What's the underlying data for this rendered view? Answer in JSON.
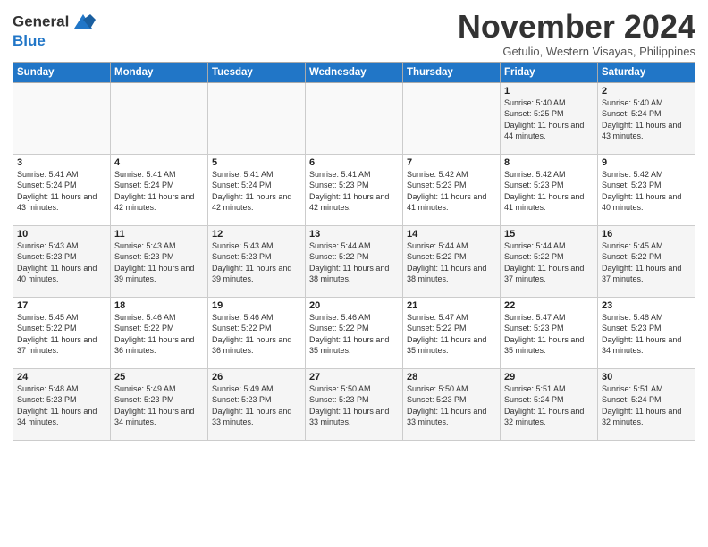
{
  "logo": {
    "line1": "General",
    "line2": "Blue"
  },
  "title": "November 2024",
  "location": "Getulio, Western Visayas, Philippines",
  "days_of_week": [
    "Sunday",
    "Monday",
    "Tuesday",
    "Wednesday",
    "Thursday",
    "Friday",
    "Saturday"
  ],
  "weeks": [
    [
      {
        "day": "",
        "info": ""
      },
      {
        "day": "",
        "info": ""
      },
      {
        "day": "",
        "info": ""
      },
      {
        "day": "",
        "info": ""
      },
      {
        "day": "",
        "info": ""
      },
      {
        "day": "1",
        "info": "Sunrise: 5:40 AM\nSunset: 5:25 PM\nDaylight: 11 hours and 44 minutes."
      },
      {
        "day": "2",
        "info": "Sunrise: 5:40 AM\nSunset: 5:24 PM\nDaylight: 11 hours and 43 minutes."
      }
    ],
    [
      {
        "day": "3",
        "info": "Sunrise: 5:41 AM\nSunset: 5:24 PM\nDaylight: 11 hours and 43 minutes."
      },
      {
        "day": "4",
        "info": "Sunrise: 5:41 AM\nSunset: 5:24 PM\nDaylight: 11 hours and 42 minutes."
      },
      {
        "day": "5",
        "info": "Sunrise: 5:41 AM\nSunset: 5:24 PM\nDaylight: 11 hours and 42 minutes."
      },
      {
        "day": "6",
        "info": "Sunrise: 5:41 AM\nSunset: 5:23 PM\nDaylight: 11 hours and 42 minutes."
      },
      {
        "day": "7",
        "info": "Sunrise: 5:42 AM\nSunset: 5:23 PM\nDaylight: 11 hours and 41 minutes."
      },
      {
        "day": "8",
        "info": "Sunrise: 5:42 AM\nSunset: 5:23 PM\nDaylight: 11 hours and 41 minutes."
      },
      {
        "day": "9",
        "info": "Sunrise: 5:42 AM\nSunset: 5:23 PM\nDaylight: 11 hours and 40 minutes."
      }
    ],
    [
      {
        "day": "10",
        "info": "Sunrise: 5:43 AM\nSunset: 5:23 PM\nDaylight: 11 hours and 40 minutes."
      },
      {
        "day": "11",
        "info": "Sunrise: 5:43 AM\nSunset: 5:23 PM\nDaylight: 11 hours and 39 minutes."
      },
      {
        "day": "12",
        "info": "Sunrise: 5:43 AM\nSunset: 5:23 PM\nDaylight: 11 hours and 39 minutes."
      },
      {
        "day": "13",
        "info": "Sunrise: 5:44 AM\nSunset: 5:22 PM\nDaylight: 11 hours and 38 minutes."
      },
      {
        "day": "14",
        "info": "Sunrise: 5:44 AM\nSunset: 5:22 PM\nDaylight: 11 hours and 38 minutes."
      },
      {
        "day": "15",
        "info": "Sunrise: 5:44 AM\nSunset: 5:22 PM\nDaylight: 11 hours and 37 minutes."
      },
      {
        "day": "16",
        "info": "Sunrise: 5:45 AM\nSunset: 5:22 PM\nDaylight: 11 hours and 37 minutes."
      }
    ],
    [
      {
        "day": "17",
        "info": "Sunrise: 5:45 AM\nSunset: 5:22 PM\nDaylight: 11 hours and 37 minutes."
      },
      {
        "day": "18",
        "info": "Sunrise: 5:46 AM\nSunset: 5:22 PM\nDaylight: 11 hours and 36 minutes."
      },
      {
        "day": "19",
        "info": "Sunrise: 5:46 AM\nSunset: 5:22 PM\nDaylight: 11 hours and 36 minutes."
      },
      {
        "day": "20",
        "info": "Sunrise: 5:46 AM\nSunset: 5:22 PM\nDaylight: 11 hours and 35 minutes."
      },
      {
        "day": "21",
        "info": "Sunrise: 5:47 AM\nSunset: 5:22 PM\nDaylight: 11 hours and 35 minutes."
      },
      {
        "day": "22",
        "info": "Sunrise: 5:47 AM\nSunset: 5:23 PM\nDaylight: 11 hours and 35 minutes."
      },
      {
        "day": "23",
        "info": "Sunrise: 5:48 AM\nSunset: 5:23 PM\nDaylight: 11 hours and 34 minutes."
      }
    ],
    [
      {
        "day": "24",
        "info": "Sunrise: 5:48 AM\nSunset: 5:23 PM\nDaylight: 11 hours and 34 minutes."
      },
      {
        "day": "25",
        "info": "Sunrise: 5:49 AM\nSunset: 5:23 PM\nDaylight: 11 hours and 34 minutes."
      },
      {
        "day": "26",
        "info": "Sunrise: 5:49 AM\nSunset: 5:23 PM\nDaylight: 11 hours and 33 minutes."
      },
      {
        "day": "27",
        "info": "Sunrise: 5:50 AM\nSunset: 5:23 PM\nDaylight: 11 hours and 33 minutes."
      },
      {
        "day": "28",
        "info": "Sunrise: 5:50 AM\nSunset: 5:23 PM\nDaylight: 11 hours and 33 minutes."
      },
      {
        "day": "29",
        "info": "Sunrise: 5:51 AM\nSunset: 5:24 PM\nDaylight: 11 hours and 32 minutes."
      },
      {
        "day": "30",
        "info": "Sunrise: 5:51 AM\nSunset: 5:24 PM\nDaylight: 11 hours and 32 minutes."
      }
    ]
  ]
}
